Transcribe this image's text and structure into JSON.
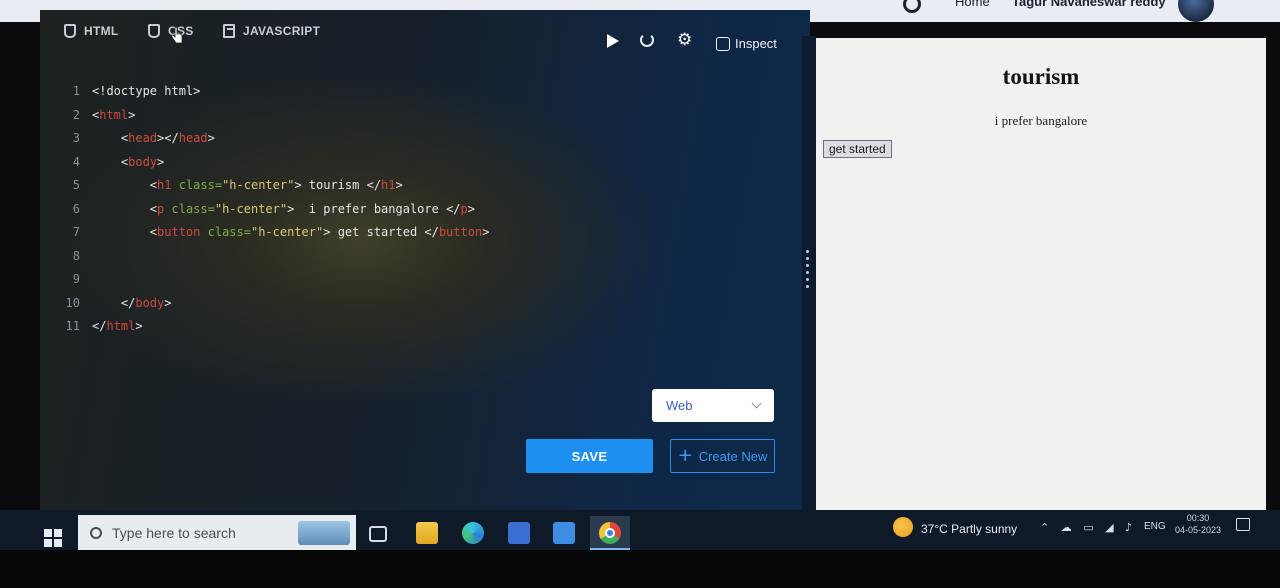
{
  "header": {
    "home": "Home",
    "user_name": "Tagur Navaneswar reddy"
  },
  "tabs": [
    {
      "label": "HTML"
    },
    {
      "label": "CSS"
    },
    {
      "label": "JAVASCRIPT"
    }
  ],
  "toolbar": {
    "inspect_label": "Inspect"
  },
  "code_lines": [
    {
      "n": "1",
      "text": "<!doctype html>"
    },
    {
      "n": "2",
      "text": "<html>"
    },
    {
      "n": "3",
      "text": "    <head></head>"
    },
    {
      "n": "4",
      "text": "    <body>"
    },
    {
      "n": "5",
      "text": "        <h1 class=\"h-center\"> tourism </h1>"
    },
    {
      "n": "6",
      "text": "        <p class=\"h-center\">  i prefer bangalore </p>"
    },
    {
      "n": "7",
      "text": "        <button class=\"h-center\"> get started </button>"
    },
    {
      "n": "8",
      "text": ""
    },
    {
      "n": "9",
      "text": ""
    },
    {
      "n": "10",
      "text": "    </body>"
    },
    {
      "n": "11",
      "text": "</html>"
    }
  ],
  "language_select": {
    "value": "Web"
  },
  "actions": {
    "save": "SAVE",
    "create_new": "Create New"
  },
  "preview": {
    "heading": "tourism",
    "paragraph": "i prefer bangalore",
    "button": "get started"
  },
  "taskbar": {
    "search_placeholder": "Type here to search",
    "weather": "37°C  Partly sunny",
    "language": "ENG",
    "time": "00:30",
    "date": "04-05-2023"
  }
}
